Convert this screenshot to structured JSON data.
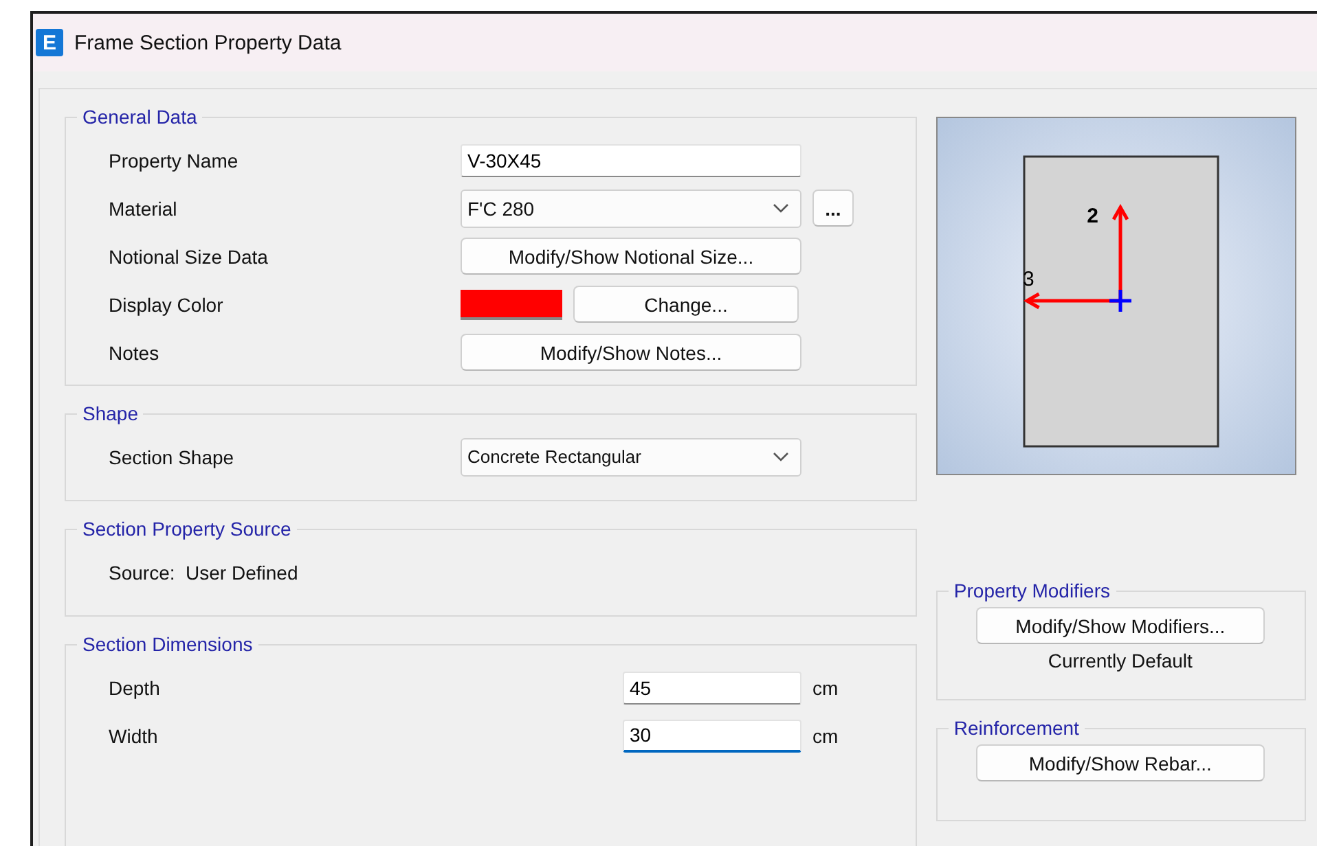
{
  "window": {
    "title": "Frame Section Property Data",
    "icon_letter": "E"
  },
  "general_data": {
    "title": "General Data",
    "property_name": {
      "label": "Property Name",
      "value": "V-30X45"
    },
    "material": {
      "label": "Material",
      "value": "F'C 280",
      "more_button": "..."
    },
    "notional_size": {
      "label": "Notional Size Data",
      "button": "Modify/Show Notional Size..."
    },
    "display_color": {
      "label": "Display Color",
      "color": "#ff0000",
      "button": "Change..."
    },
    "notes": {
      "label": "Notes",
      "button": "Modify/Show Notes..."
    }
  },
  "shape": {
    "title": "Shape",
    "label": "Section Shape",
    "value": "Concrete Rectangular"
  },
  "property_source": {
    "title": "Section Property Source",
    "text": "Source:  User Defined"
  },
  "dimensions": {
    "title": "Section Dimensions",
    "fields": [
      {
        "label": "Depth",
        "value": "45",
        "unit": "cm",
        "focused": false
      },
      {
        "label": "Width",
        "value": "30",
        "unit": "cm",
        "focused": true
      }
    ]
  },
  "preview": {
    "axis_2_label": "2",
    "axis_3_label": "3"
  },
  "property_modifiers": {
    "title": "Property Modifiers",
    "button": "Modify/Show Modifiers...",
    "status": "Currently Default"
  },
  "reinforcement": {
    "title": "Reinforcement",
    "button": "Modify/Show Rebar..."
  }
}
